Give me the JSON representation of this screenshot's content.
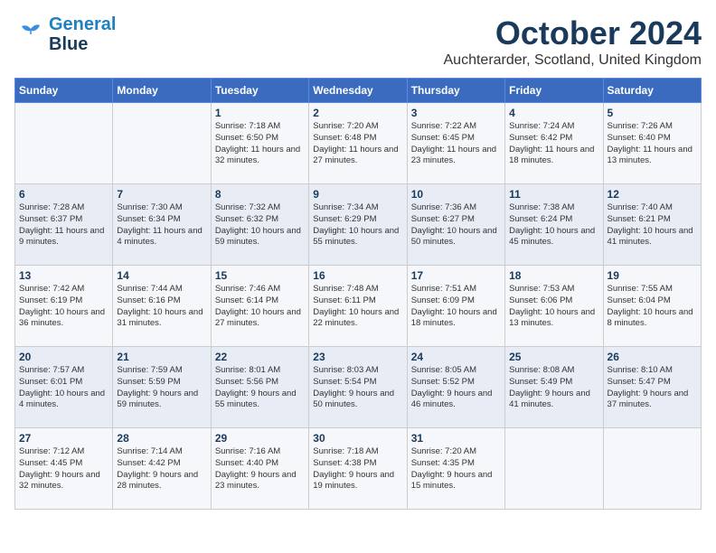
{
  "header": {
    "logo_general": "General",
    "logo_blue": "Blue",
    "month": "October 2024",
    "location": "Auchterarder, Scotland, United Kingdom"
  },
  "weekdays": [
    "Sunday",
    "Monday",
    "Tuesday",
    "Wednesday",
    "Thursday",
    "Friday",
    "Saturday"
  ],
  "weeks": [
    [
      {
        "day": "",
        "text": ""
      },
      {
        "day": "",
        "text": ""
      },
      {
        "day": "1",
        "text": "Sunrise: 7:18 AM\nSunset: 6:50 PM\nDaylight: 11 hours and 32 minutes."
      },
      {
        "day": "2",
        "text": "Sunrise: 7:20 AM\nSunset: 6:48 PM\nDaylight: 11 hours and 27 minutes."
      },
      {
        "day": "3",
        "text": "Sunrise: 7:22 AM\nSunset: 6:45 PM\nDaylight: 11 hours and 23 minutes."
      },
      {
        "day": "4",
        "text": "Sunrise: 7:24 AM\nSunset: 6:42 PM\nDaylight: 11 hours and 18 minutes."
      },
      {
        "day": "5",
        "text": "Sunrise: 7:26 AM\nSunset: 6:40 PM\nDaylight: 11 hours and 13 minutes."
      }
    ],
    [
      {
        "day": "6",
        "text": "Sunrise: 7:28 AM\nSunset: 6:37 PM\nDaylight: 11 hours and 9 minutes."
      },
      {
        "day": "7",
        "text": "Sunrise: 7:30 AM\nSunset: 6:34 PM\nDaylight: 11 hours and 4 minutes."
      },
      {
        "day": "8",
        "text": "Sunrise: 7:32 AM\nSunset: 6:32 PM\nDaylight: 10 hours and 59 minutes."
      },
      {
        "day": "9",
        "text": "Sunrise: 7:34 AM\nSunset: 6:29 PM\nDaylight: 10 hours and 55 minutes."
      },
      {
        "day": "10",
        "text": "Sunrise: 7:36 AM\nSunset: 6:27 PM\nDaylight: 10 hours and 50 minutes."
      },
      {
        "day": "11",
        "text": "Sunrise: 7:38 AM\nSunset: 6:24 PM\nDaylight: 10 hours and 45 minutes."
      },
      {
        "day": "12",
        "text": "Sunrise: 7:40 AM\nSunset: 6:21 PM\nDaylight: 10 hours and 41 minutes."
      }
    ],
    [
      {
        "day": "13",
        "text": "Sunrise: 7:42 AM\nSunset: 6:19 PM\nDaylight: 10 hours and 36 minutes."
      },
      {
        "day": "14",
        "text": "Sunrise: 7:44 AM\nSunset: 6:16 PM\nDaylight: 10 hours and 31 minutes."
      },
      {
        "day": "15",
        "text": "Sunrise: 7:46 AM\nSunset: 6:14 PM\nDaylight: 10 hours and 27 minutes."
      },
      {
        "day": "16",
        "text": "Sunrise: 7:48 AM\nSunset: 6:11 PM\nDaylight: 10 hours and 22 minutes."
      },
      {
        "day": "17",
        "text": "Sunrise: 7:51 AM\nSunset: 6:09 PM\nDaylight: 10 hours and 18 minutes."
      },
      {
        "day": "18",
        "text": "Sunrise: 7:53 AM\nSunset: 6:06 PM\nDaylight: 10 hours and 13 minutes."
      },
      {
        "day": "19",
        "text": "Sunrise: 7:55 AM\nSunset: 6:04 PM\nDaylight: 10 hours and 8 minutes."
      }
    ],
    [
      {
        "day": "20",
        "text": "Sunrise: 7:57 AM\nSunset: 6:01 PM\nDaylight: 10 hours and 4 minutes."
      },
      {
        "day": "21",
        "text": "Sunrise: 7:59 AM\nSunset: 5:59 PM\nDaylight: 9 hours and 59 minutes."
      },
      {
        "day": "22",
        "text": "Sunrise: 8:01 AM\nSunset: 5:56 PM\nDaylight: 9 hours and 55 minutes."
      },
      {
        "day": "23",
        "text": "Sunrise: 8:03 AM\nSunset: 5:54 PM\nDaylight: 9 hours and 50 minutes."
      },
      {
        "day": "24",
        "text": "Sunrise: 8:05 AM\nSunset: 5:52 PM\nDaylight: 9 hours and 46 minutes."
      },
      {
        "day": "25",
        "text": "Sunrise: 8:08 AM\nSunset: 5:49 PM\nDaylight: 9 hours and 41 minutes."
      },
      {
        "day": "26",
        "text": "Sunrise: 8:10 AM\nSunset: 5:47 PM\nDaylight: 9 hours and 37 minutes."
      }
    ],
    [
      {
        "day": "27",
        "text": "Sunrise: 7:12 AM\nSunset: 4:45 PM\nDaylight: 9 hours and 32 minutes."
      },
      {
        "day": "28",
        "text": "Sunrise: 7:14 AM\nSunset: 4:42 PM\nDaylight: 9 hours and 28 minutes."
      },
      {
        "day": "29",
        "text": "Sunrise: 7:16 AM\nSunset: 4:40 PM\nDaylight: 9 hours and 23 minutes."
      },
      {
        "day": "30",
        "text": "Sunrise: 7:18 AM\nSunset: 4:38 PM\nDaylight: 9 hours and 19 minutes."
      },
      {
        "day": "31",
        "text": "Sunrise: 7:20 AM\nSunset: 4:35 PM\nDaylight: 9 hours and 15 minutes."
      },
      {
        "day": "",
        "text": ""
      },
      {
        "day": "",
        "text": ""
      }
    ]
  ]
}
